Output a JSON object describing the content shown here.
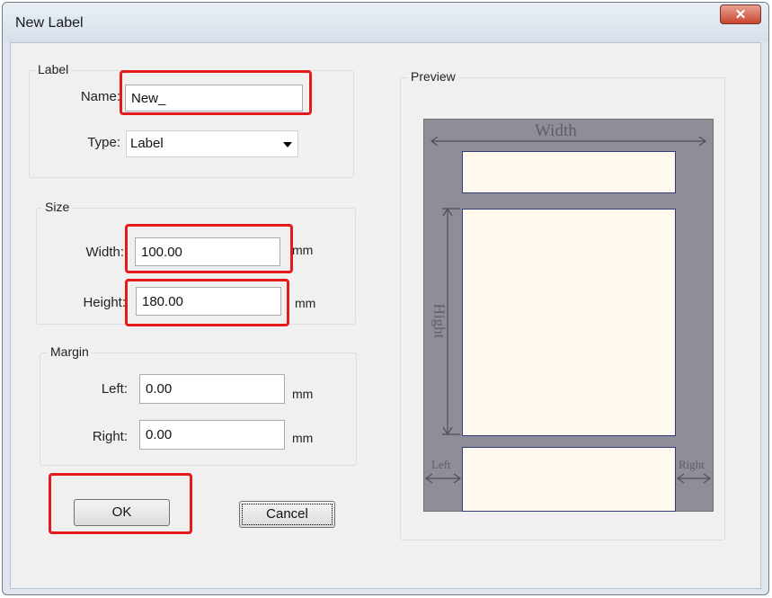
{
  "window": {
    "title": "New Label",
    "close_glyph": "✕"
  },
  "label_group": {
    "title": "Label",
    "name_label": "Name:",
    "name_value": "New_",
    "type_label": "Type:",
    "type_value": "Label"
  },
  "size_group": {
    "title": "Size",
    "width_label": "Width:",
    "width_value": "100.00",
    "width_unit": "mm",
    "height_label": "Height:",
    "height_value": "180.00",
    "height_unit": "mm"
  },
  "margin_group": {
    "title": "Margin",
    "left_label": "Left:",
    "left_value": "0.00",
    "left_unit": "mm",
    "right_label": "Right:",
    "right_value": "0.00",
    "right_unit": "mm"
  },
  "buttons": {
    "ok": "OK",
    "cancel": "Cancel"
  },
  "preview": {
    "title": "Preview",
    "width_label": "Width",
    "height_label": "Hight",
    "left_label": "Left",
    "right_label": "Right"
  },
  "colors": {
    "highlight": "#e31b1b",
    "preview_bg": "#8e8e98",
    "paper": "#fff9ee"
  }
}
